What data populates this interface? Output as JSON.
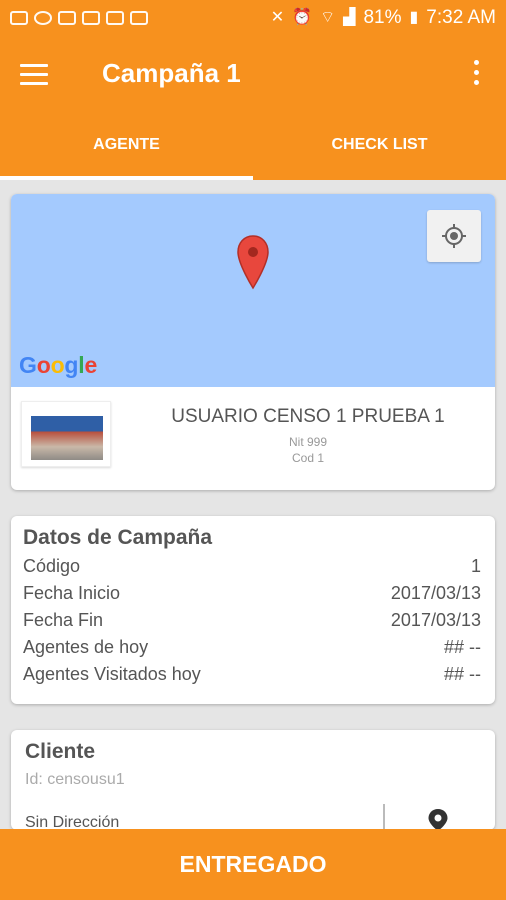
{
  "status_bar": {
    "battery": "81%",
    "time": "7:32 AM"
  },
  "app_bar": {
    "title": "Campaña 1"
  },
  "tabs": [
    {
      "label": "AGENTE",
      "active": true
    },
    {
      "label": "CHECK LIST",
      "active": false
    }
  ],
  "map": {
    "logo_text": "Google"
  },
  "agent": {
    "name": "USUARIO CENSO 1 PRUEBA 1",
    "nit": "Nit 999",
    "cod": "Cod 1"
  },
  "datos": {
    "title": "Datos de Campaña",
    "rows": [
      {
        "label": "Código",
        "value": "1"
      },
      {
        "label": "Fecha Inicio",
        "value": "2017/03/13"
      },
      {
        "label": "Fecha Fin",
        "value": "2017/03/13"
      },
      {
        "label": "Agentes de hoy",
        "value": "## --"
      },
      {
        "label": "Agentes Visitados hoy",
        "value": "## --"
      }
    ]
  },
  "cliente": {
    "title": "Cliente",
    "id": "Id: censousu1",
    "address": "Sin Dirección"
  },
  "footer": {
    "button_label": "ENTREGADO"
  },
  "colors": {
    "accent": "#f7911e",
    "map": "#a4cafe",
    "pin": "#e8473d"
  },
  "icons": [
    "menu-icon",
    "overflow-icon",
    "location-pin-icon",
    "my-location-icon",
    "place-icon"
  ]
}
